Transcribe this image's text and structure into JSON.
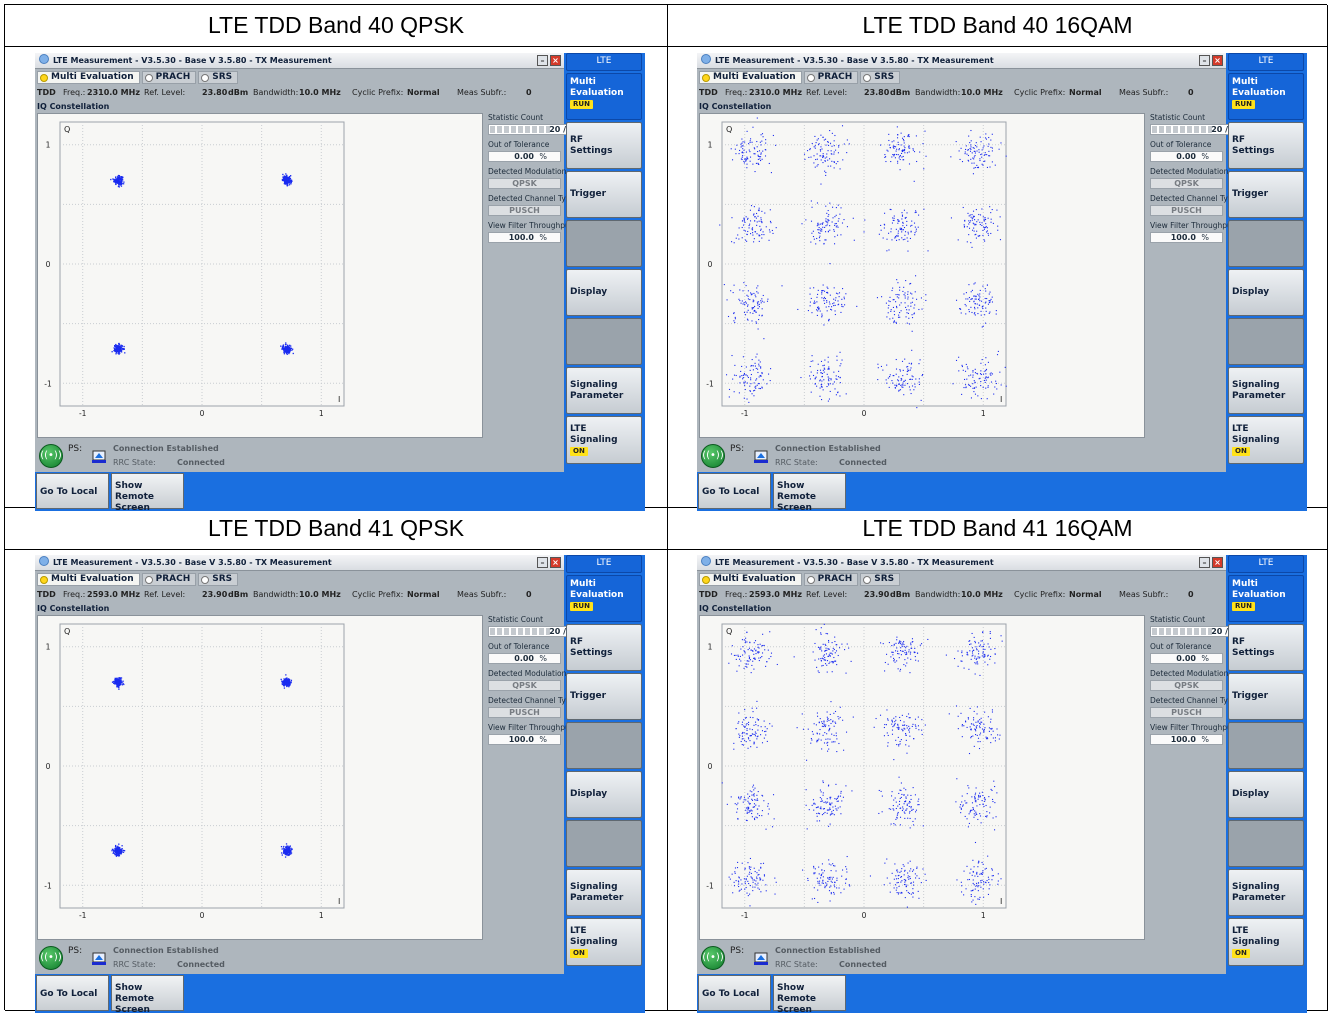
{
  "cells": [
    {
      "heading": "LTE TDD Band 40 QPSK",
      "modulation": "QPSK",
      "window": {
        "title": "LTE Measurement  - V3.5.30 - Base V 3.5.80 - TX Measurement",
        "tabs": [
          "Multi Evaluation",
          "PRACH",
          "SRS"
        ],
        "info": {
          "duplex": "TDD",
          "freq_label": "Freq.:",
          "freq_value": "2310.0 MHz",
          "ref_label": "Ref. Level:",
          "ref_value": "23.80",
          "ref_unit": "dBm",
          "bw_label": "Bandwidth:",
          "bw_value": "10.0 MHz",
          "cp_label": "Cyclic Prefix:",
          "cp_value": "Normal",
          "subfr_label": "Meas Subfr.:",
          "subfr_value": "0"
        },
        "plot_title": "IQ Constellation",
        "plot": {
          "y_axis_label": "Q",
          "x_axis_label": "I",
          "y_ticks": [
            "1",
            "0",
            "-1"
          ],
          "x_ticks": [
            "-1",
            "0",
            "1"
          ]
        },
        "stats": {
          "statistic_count_label": "Statistic Count",
          "statistic_count_value": "20 / 20",
          "statistic_count_fraction": 1.0,
          "out_of_tolerance_label": "Out of Tolerance",
          "out_of_tolerance_value": "0.00",
          "out_of_tolerance_unit": "%",
          "detected_modulation_label": "Detected Modulation",
          "detected_modulation_value": "QPSK",
          "detected_channel_type_label": "Detected Channel Type",
          "detected_channel_type_value": "PUSCH",
          "view_filter_throughput_label": "View Filter Throughput",
          "view_filter_throughput_value": "100.0",
          "view_filter_throughput_unit": "%"
        },
        "status": {
          "ps_label": "PS:",
          "connection_text": "Connection Established",
          "rrc_label": "RRC State:",
          "rrc_value": "Connected"
        }
      },
      "softkeys": {
        "ribbon": "LTE",
        "multi_line1": "Multi",
        "multi_line2": "Evaluation",
        "multi_badge": "RUN",
        "rf_line1": "RF",
        "rf_line2": "Settings",
        "trigger": "Trigger",
        "display": "Display",
        "sig_line1": "Signaling",
        "sig_line2": "Parameter",
        "lte_line1": "LTE",
        "lte_line2": "Signaling",
        "lte_badge": "ON"
      },
      "bottom": {
        "go_local": "Go To Local",
        "remote_line1": "Show Remote",
        "remote_line2": "Screen"
      }
    },
    {
      "heading": "LTE TDD Band 40 16QAM",
      "modulation": "16QAM",
      "window": {
        "title": "LTE Measurement  - V3.5.30 - Base V 3.5.80 - TX Measurement",
        "tabs": [
          "Multi Evaluation",
          "PRACH",
          "SRS"
        ],
        "info": {
          "duplex": "TDD",
          "freq_label": "Freq.:",
          "freq_value": "2310.0 MHz",
          "ref_label": "Ref. Level:",
          "ref_value": "23.80",
          "ref_unit": "dBm",
          "bw_label": "Bandwidth:",
          "bw_value": "10.0 MHz",
          "cp_label": "Cyclic Prefix:",
          "cp_value": "Normal",
          "subfr_label": "Meas Subfr.:",
          "subfr_value": "0"
        },
        "plot_title": "IQ Constellation",
        "plot": {
          "y_axis_label": "Q",
          "x_axis_label": "I",
          "y_ticks": [
            "1",
            "0",
            "-1"
          ],
          "x_ticks": [
            "-1",
            "0",
            "1"
          ]
        },
        "stats": {
          "statistic_count_label": "Statistic Count",
          "statistic_count_value": "20 / 20",
          "statistic_count_fraction": 1.0,
          "out_of_tolerance_label": "Out of Tolerance",
          "out_of_tolerance_value": "0.00",
          "out_of_tolerance_unit": "%",
          "detected_modulation_label": "Detected Modulation",
          "detected_modulation_value": "QPSK",
          "detected_channel_type_label": "Detected Channel Type",
          "detected_channel_type_value": "PUSCH",
          "view_filter_throughput_label": "View Filter Throughput",
          "view_filter_throughput_value": "100.0",
          "view_filter_throughput_unit": "%"
        },
        "status": {
          "ps_label": "PS:",
          "connection_text": "Connection Established",
          "rrc_label": "RRC State:",
          "rrc_value": "Connected"
        }
      },
      "softkeys": {
        "ribbon": "LTE",
        "multi_line1": "Multi",
        "multi_line2": "Evaluation",
        "multi_badge": "RUN",
        "rf_line1": "RF",
        "rf_line2": "Settings",
        "trigger": "Trigger",
        "display": "Display",
        "sig_line1": "Signaling",
        "sig_line2": "Parameter",
        "lte_line1": "LTE",
        "lte_line2": "Signaling",
        "lte_badge": "ON"
      },
      "bottom": {
        "go_local": "Go To Local",
        "remote_line1": "Show Remote",
        "remote_line2": "Screen"
      }
    },
    {
      "heading": "LTE TDD Band 41 QPSK",
      "modulation": "QPSK",
      "window": {
        "title": "LTE Measurement  - V3.5.30 - Base V 3.5.80 - TX Measurement",
        "tabs": [
          "Multi Evaluation",
          "PRACH",
          "SRS"
        ],
        "info": {
          "duplex": "TDD",
          "freq_label": "Freq.:",
          "freq_value": "2593.0 MHz",
          "ref_label": "Ref. Level:",
          "ref_value": "23.90",
          "ref_unit": "dBm",
          "bw_label": "Bandwidth:",
          "bw_value": "10.0 MHz",
          "cp_label": "Cyclic Prefix:",
          "cp_value": "Normal",
          "subfr_label": "Meas Subfr.:",
          "subfr_value": "0"
        },
        "plot_title": "IQ Constellation",
        "plot": {
          "y_axis_label": "Q",
          "x_axis_label": "I",
          "y_ticks": [
            "1",
            "0",
            "-1"
          ],
          "x_ticks": [
            "-1",
            "0",
            "1"
          ]
        },
        "stats": {
          "statistic_count_label": "Statistic Count",
          "statistic_count_value": "20 / 20",
          "statistic_count_fraction": 1.0,
          "out_of_tolerance_label": "Out of Tolerance",
          "out_of_tolerance_value": "0.00",
          "out_of_tolerance_unit": "%",
          "detected_modulation_label": "Detected Modulation",
          "detected_modulation_value": "QPSK",
          "detected_channel_type_label": "Detected Channel Type",
          "detected_channel_type_value": "PUSCH",
          "view_filter_throughput_label": "View Filter Throughput",
          "view_filter_throughput_value": "100.0",
          "view_filter_throughput_unit": "%"
        },
        "status": {
          "ps_label": "PS:",
          "connection_text": "Connection Established",
          "rrc_label": "RRC State:",
          "rrc_value": "Connected"
        }
      },
      "softkeys": {
        "ribbon": "LTE",
        "multi_line1": "Multi",
        "multi_line2": "Evaluation",
        "multi_badge": "RUN",
        "rf_line1": "RF",
        "rf_line2": "Settings",
        "trigger": "Trigger",
        "display": "Display",
        "sig_line1": "Signaling",
        "sig_line2": "Parameter",
        "lte_line1": "LTE",
        "lte_line2": "Signaling",
        "lte_badge": "ON"
      },
      "bottom": {
        "go_local": "Go To Local",
        "remote_line1": "Show Remote",
        "remote_line2": "Screen"
      }
    },
    {
      "heading": "LTE TDD Band 41 16QAM",
      "modulation": "16QAM",
      "window": {
        "title": "LTE Measurement  - V3.5.30 - Base V 3.5.80 - TX Measurement",
        "tabs": [
          "Multi Evaluation",
          "PRACH",
          "SRS"
        ],
        "info": {
          "duplex": "TDD",
          "freq_label": "Freq.:",
          "freq_value": "2593.0 MHz",
          "ref_label": "Ref. Level:",
          "ref_value": "23.90",
          "ref_unit": "dBm",
          "bw_label": "Bandwidth:",
          "bw_value": "10.0 MHz",
          "cp_label": "Cyclic Prefix:",
          "cp_value": "Normal",
          "subfr_label": "Meas Subfr.:",
          "subfr_value": "0"
        },
        "plot_title": "IQ Constellation",
        "plot": {
          "y_axis_label": "Q",
          "x_axis_label": "I",
          "y_ticks": [
            "1",
            "0",
            "-1"
          ],
          "x_ticks": [
            "-1",
            "0",
            "1"
          ]
        },
        "stats": {
          "statistic_count_label": "Statistic Count",
          "statistic_count_value": "20 / 20",
          "statistic_count_fraction": 1.0,
          "out_of_tolerance_label": "Out of Tolerance",
          "out_of_tolerance_value": "0.00",
          "out_of_tolerance_unit": "%",
          "detected_modulation_label": "Detected Modulation",
          "detected_modulation_value": "QPSK",
          "detected_channel_type_label": "Detected Channel Type",
          "detected_channel_type_value": "PUSCH",
          "view_filter_throughput_label": "View Filter Throughput",
          "view_filter_throughput_value": "100.0",
          "view_filter_throughput_unit": "%"
        },
        "status": {
          "ps_label": "PS:",
          "connection_text": "Connection Established",
          "rrc_label": "RRC State:",
          "rrc_value": "Connected"
        }
      },
      "softkeys": {
        "ribbon": "LTE",
        "multi_line1": "Multi",
        "multi_line2": "Evaluation",
        "multi_badge": "RUN",
        "rf_line1": "RF",
        "rf_line2": "Settings",
        "trigger": "Trigger",
        "display": "Display",
        "sig_line1": "Signaling",
        "sig_line2": "Parameter",
        "lte_line1": "LTE",
        "lte_line2": "Signaling",
        "lte_badge": "ON"
      },
      "bottom": {
        "go_local": "Go To Local",
        "remote_line1": "Show Remote",
        "remote_line2": "Screen"
      }
    }
  ],
  "colors": {
    "constellation_points": "#1a2bf0",
    "softkey_active": "#1565d8",
    "screen_background": "#1a6fe0",
    "badge": "#ffe21a"
  }
}
